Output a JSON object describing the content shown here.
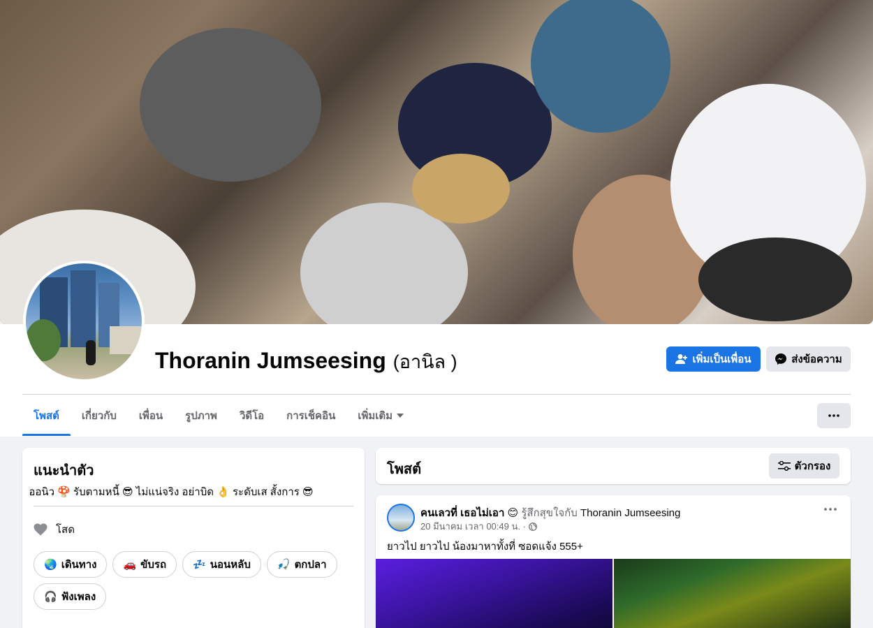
{
  "profile": {
    "name": "Thoranin Jumseesing",
    "alt_name": "(อานิล )",
    "add_friend_label": "เพิ่มเป็นเพื่อน",
    "message_label": "ส่งข้อความ"
  },
  "tabs": [
    {
      "label": "โพสต์",
      "active": true
    },
    {
      "label": "เกี่ยวกับ"
    },
    {
      "label": "เพื่อน"
    },
    {
      "label": "รูปภาพ"
    },
    {
      "label": "วิดีโอ"
    },
    {
      "label": "การเช็คอิน"
    },
    {
      "label": "เพิ่มเติม"
    }
  ],
  "intro": {
    "title": "แนะนำตัว",
    "bio": "ออนิว 🍄 รับตามหนี้ 😎 ไม่แน่จริง อย่าบิด 👌 ระดับเส สั้งการ 😎",
    "relationship": "โสด",
    "hobbies": [
      {
        "emoji": "🌏",
        "label": "เดินทาง"
      },
      {
        "emoji": "🚗",
        "label": "ขับรถ"
      },
      {
        "emoji": "💤",
        "label": "นอนหลับ"
      },
      {
        "emoji": "🎣",
        "label": "ตกปลา"
      },
      {
        "emoji": "🎧",
        "label": "ฟังเพลง"
      }
    ]
  },
  "posts_section": {
    "title": "โพสต์",
    "filter_label": "ตัวกรอง"
  },
  "post": {
    "author": "คนเลวที่ เธอไม่เอา",
    "author_emoji": "😊",
    "feeling": "รู้สึกสุขใจกับ",
    "tagged": "Thoranin Jumseesing",
    "date": "20 มีนาคม เวลา 00:49 น. ·",
    "text": "ยาวไป ยาวไป น้องมาหาทั้งที่ ซอดแจ้ง 555+"
  },
  "colors": {
    "primary": "#1b74e4",
    "secondary_bg": "#e4e6eb",
    "page_bg": "#f0f2f5",
    "muted_text": "#65676b"
  },
  "icons": [
    "add-friend-icon",
    "messenger-icon",
    "caret-down-icon",
    "more-dots-icon",
    "heart-icon",
    "filter-icon",
    "globe-icon"
  ]
}
